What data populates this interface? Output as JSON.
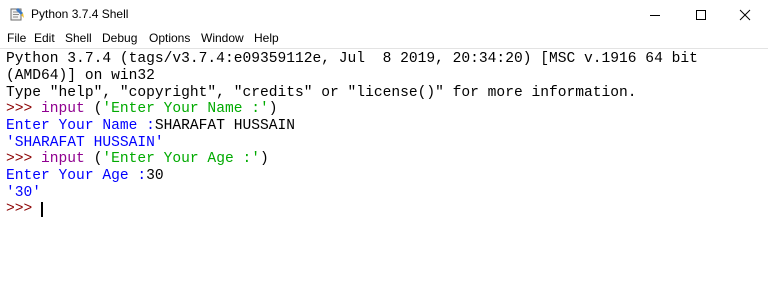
{
  "window": {
    "title": "Python 3.7.4 Shell",
    "controls": {
      "minimize": "minimize",
      "maximize": "maximize",
      "close": "close"
    }
  },
  "menu": {
    "items": [
      "File",
      "Edit",
      "Shell",
      "Debug",
      "Options",
      "Window",
      "Help"
    ]
  },
  "shell": {
    "banner_line1": "Python 3.7.4 (tags/v3.7.4:e09359112e, Jul  8 2019, 20:34:20) [MSC v.1916 64 bit",
    "banner_line2": "(AMD64)] on win32",
    "banner_line3": "Type \"help\", \"copyright\", \"credits\" or \"license()\" for more information.",
    "prompt": ">>> ",
    "cmd1_fn": "input",
    "cmd1_open": " (",
    "cmd1_str": "'Enter Your Name :'",
    "cmd1_close": ")",
    "out1_prompt": "Enter Your Name :",
    "out1_input": "SHARAFAT HUSSAIN",
    "result1": "'SHARAFAT HUSSAIN'",
    "cmd2_fn": "input",
    "cmd2_open": " (",
    "cmd2_str": "'Enter Your Age :'",
    "cmd2_close": ")",
    "out2_prompt": "Enter Your Age :",
    "out2_input": "30",
    "result2": "'30'"
  },
  "colors": {
    "prompt": "#8b0000",
    "builtin": "#900090",
    "string": "#00aa00",
    "stdout": "#0000ff"
  }
}
